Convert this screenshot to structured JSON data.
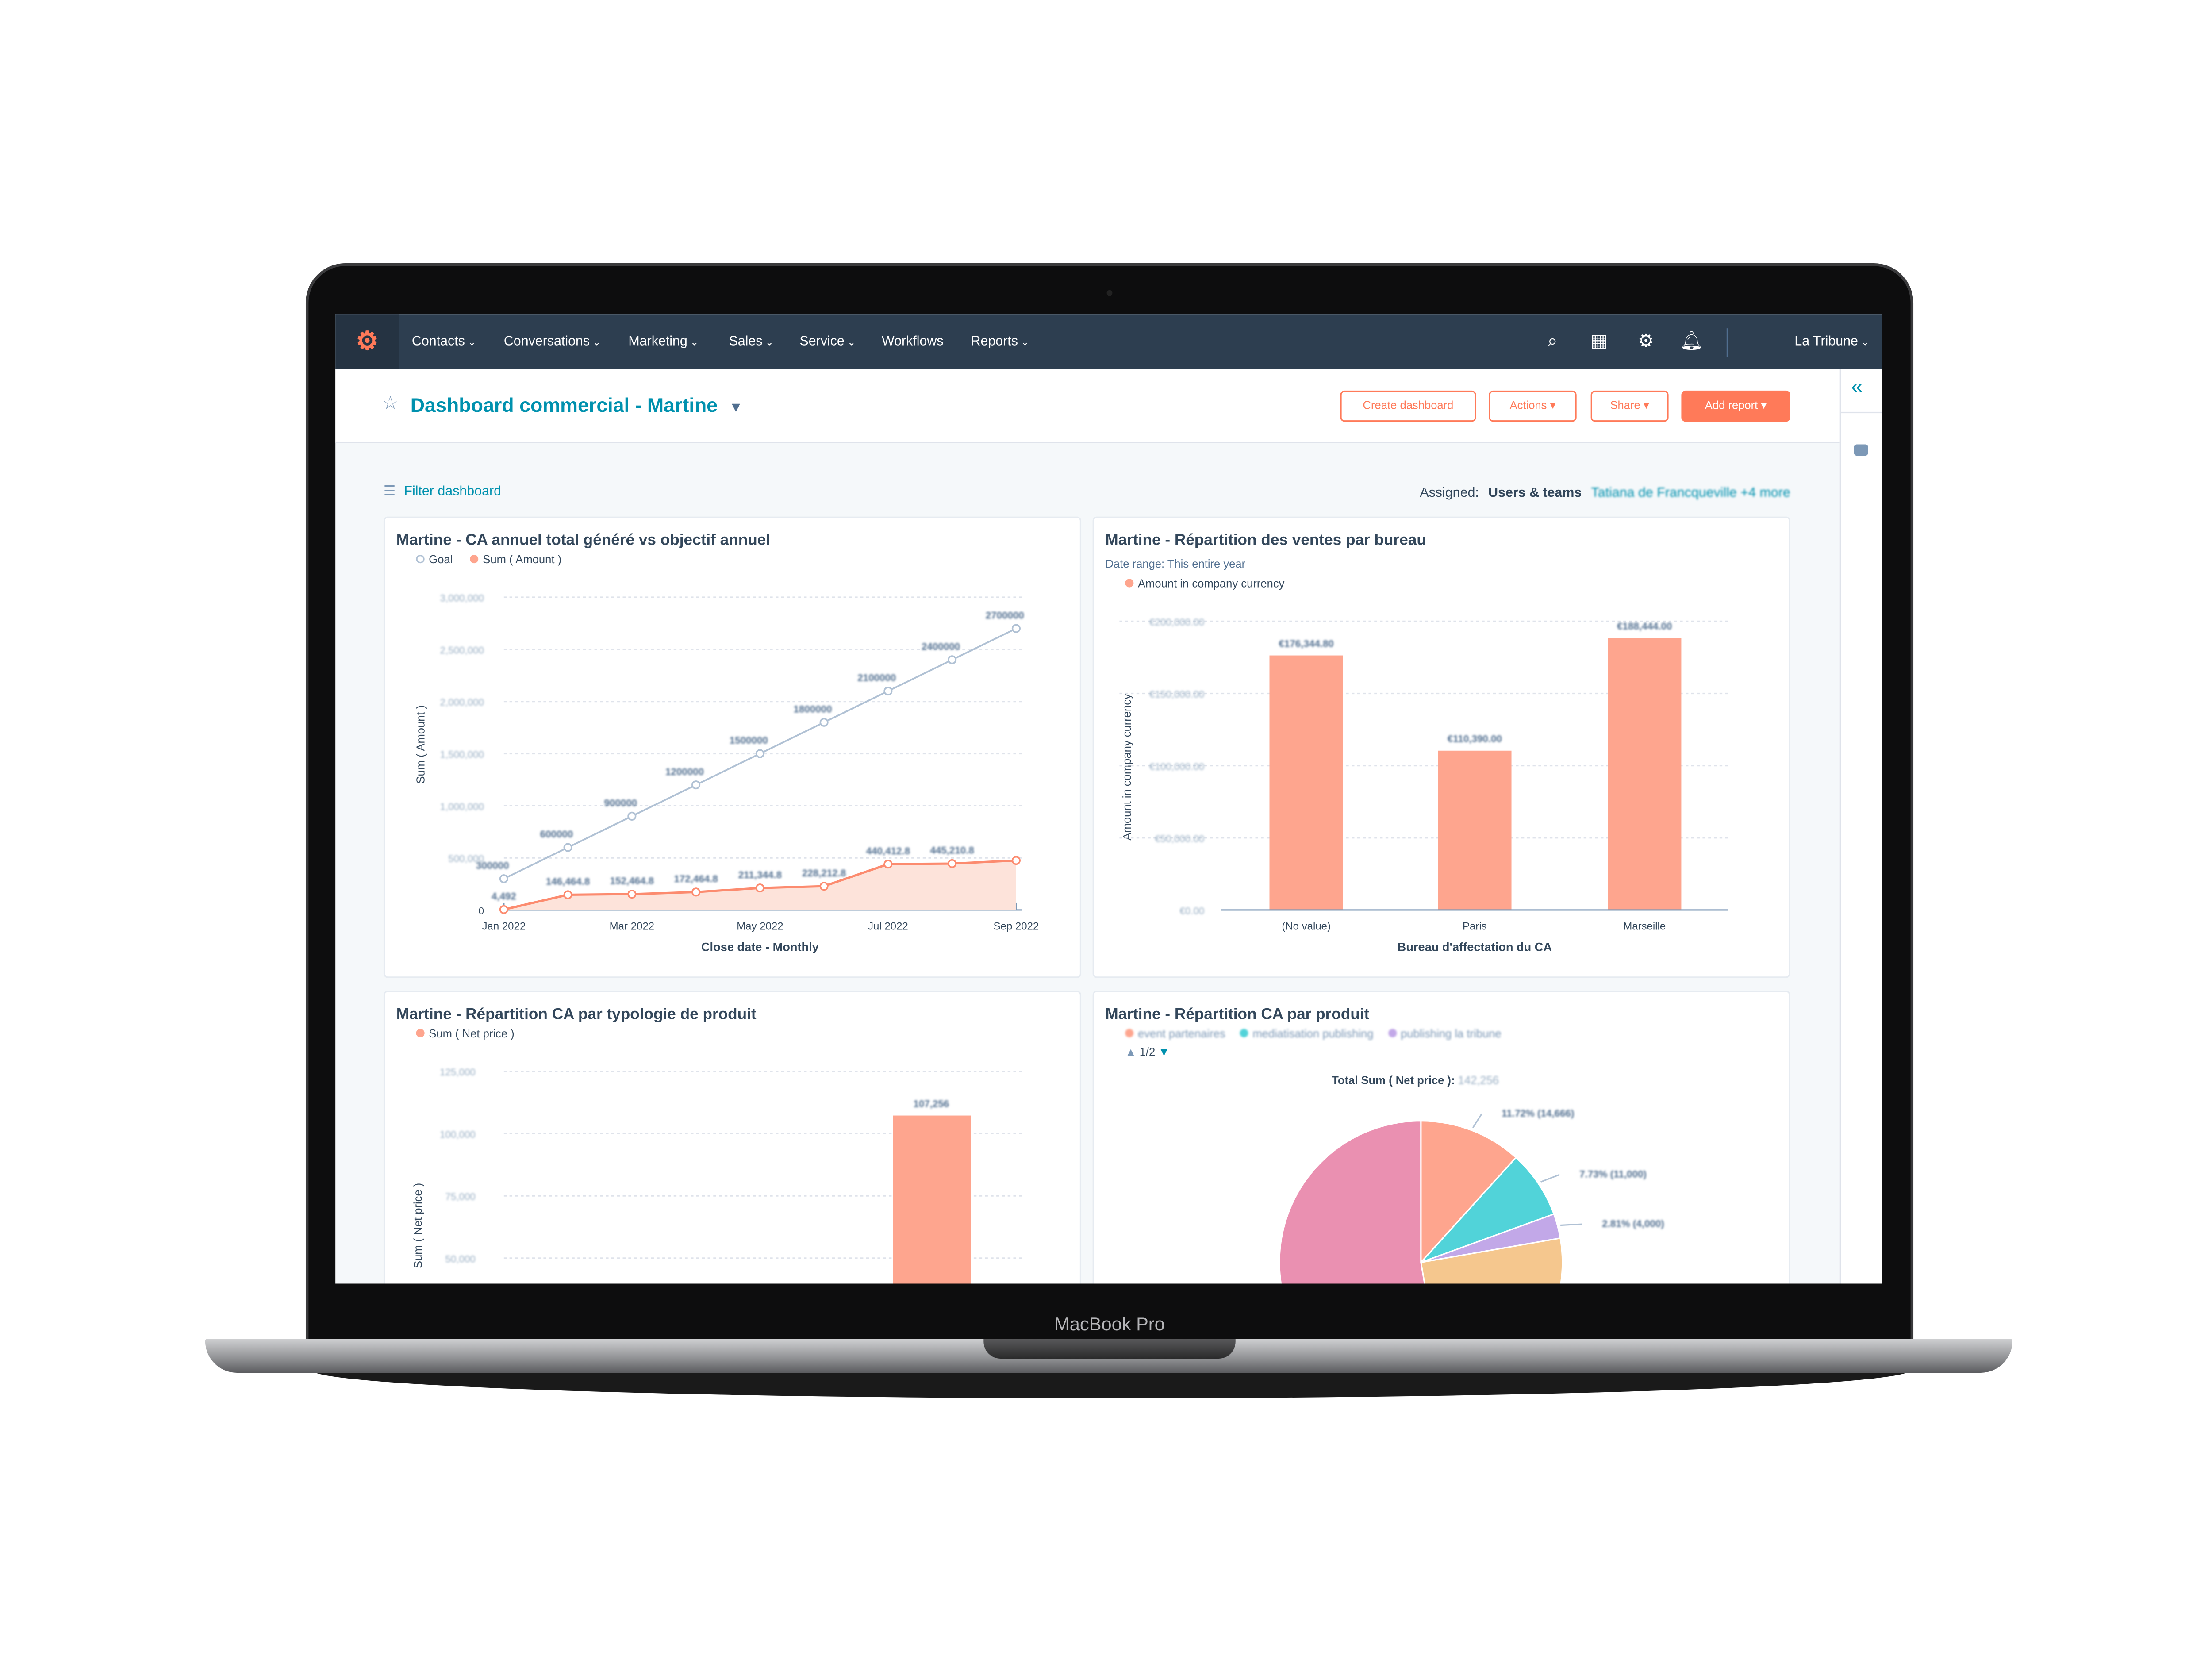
{
  "device": {
    "brand_label": "MacBook Pro"
  },
  "nav": {
    "logo_icon": "hubspot-sprocket-icon",
    "items": [
      {
        "label": "Contacts"
      },
      {
        "label": "Conversations"
      },
      {
        "label": "Marketing"
      },
      {
        "label": "Sales"
      },
      {
        "label": "Service"
      },
      {
        "label": "Workflows"
      },
      {
        "label": "Reports"
      }
    ],
    "icons": [
      "search-icon",
      "marketplace-icon",
      "gear-icon",
      "bell-icon"
    ],
    "account": "La Tribune"
  },
  "header": {
    "title": "Dashboard commercial - Martine",
    "buttons": {
      "create": "Create dashboard",
      "actions": "Actions",
      "share": "Share",
      "add_report": "Add report"
    }
  },
  "filter": {
    "label": "Filter dashboard",
    "assigned_label": "Assigned:",
    "assigned_value": "Users & teams",
    "assigned_users": "Tatiana de Francqueville +4 more"
  },
  "colors": {
    "accent": "#ff7a59",
    "link": "#0091ae",
    "nav": "#2d3e50",
    "bar": "#fea58e",
    "goal": "#b0c1d4"
  },
  "chart_data": [
    {
      "type": "line",
      "title": "Martine - CA annuel total généré vs objectif annuel",
      "xlabel": "Close date - Monthly",
      "ylabel": "Sum ( Amount )",
      "x": [
        "Jan 2022",
        "Feb 2022",
        "Mar 2022",
        "Apr 2022",
        "May 2022",
        "Jun 2022",
        "Jul 2022",
        "Aug 2022",
        "Sep 2022"
      ],
      "xticks": [
        "Jan 2022",
        "Mar 2022",
        "May 2022",
        "Jul 2022",
        "Sep 2022"
      ],
      "yticks": [
        "0",
        "500,000",
        "1,000,000",
        "1,500,000",
        "2,000,000",
        "2,500,000",
        "3,000,000"
      ],
      "ylim": [
        0,
        3000000
      ],
      "legend": "top-left",
      "grid": true,
      "series": [
        {
          "name": "Goal",
          "values": [
            300000,
            600000,
            900000,
            1200000,
            1500000,
            1800000,
            2100000,
            2400000,
            2700000
          ],
          "labels": [
            "300000",
            "600000",
            "900000",
            "1200000",
            "1500000",
            "1800000",
            "2100000",
            "2400000",
            "2700000"
          ]
        },
        {
          "name": "Sum ( Amount )",
          "values": [
            4492,
            146464.8,
            152464.8,
            172464.8,
            211344.8,
            228212.8,
            440412.8,
            445210.8,
            475000
          ],
          "labels": [
            "4,492",
            "146,464.8",
            "152,464.8",
            "172,464.8",
            "211,344.8",
            "228,212.8",
            "440,412.8",
            "445,210.8",
            ""
          ]
        }
      ]
    },
    {
      "type": "bar",
      "title": "Martine - Répartition des ventes par bureau",
      "subtitle": "Date range: This entire year",
      "xlabel": "Bureau d'affectation du CA",
      "ylabel": "Amount in company currency",
      "categories": [
        "(No value)",
        "Paris",
        "Marseille"
      ],
      "values": [
        176344.8,
        110390,
        188444
      ],
      "labels": [
        "€176,344.80",
        "€110,390.00",
        "€188,444.00"
      ],
      "yticks": [
        "€0.00",
        "€50,000.00",
        "€100,000.00",
        "€150,000.00",
        "€200,000.00"
      ],
      "ylim": [
        0,
        200000
      ],
      "legend": "top-left",
      "grid": true,
      "series": [
        {
          "name": "Amount in company currency"
        }
      ]
    },
    {
      "type": "bar",
      "title": "Martine - Répartition CA par typologie de produit",
      "ylabel": "Sum ( Net price )",
      "values": [
        107256
      ],
      "labels": [
        "107,256"
      ],
      "yticks": [
        "50,000",
        "75,000",
        "100,000",
        "125,000"
      ],
      "ylim": [
        0,
        125000
      ],
      "legend": "top-left",
      "grid": true,
      "series": [
        {
          "name": "Sum ( Net price )"
        }
      ]
    },
    {
      "type": "pie",
      "title": "Martine - Répartition CA par produit",
      "total_label": "Total Sum ( Net price ):",
      "total_value": "142,256",
      "legend_page": "1/2",
      "legend": [
        "event partenaires",
        "mediatisation publishing",
        "publishing la tribune"
      ],
      "slices": [
        {
          "name": "event partenaires",
          "percent": 11.72,
          "value": 14666,
          "label": "11.72% (14,666)",
          "color": "#fea58e"
        },
        {
          "name": "mediatisation publishing",
          "percent": 7.73,
          "value": 11000,
          "label": "7.73% (11,000)",
          "color": "#51d3d9"
        },
        {
          "name": "publishing la tribune",
          "percent": 2.81,
          "value": 4000,
          "label": "2.81% (4,000)",
          "color": "#c2a8e8"
        },
        {
          "percent": 25,
          "color": "#f5c78e"
        },
        {
          "percent": 52.74,
          "color": "#ea90b1"
        }
      ]
    }
  ]
}
